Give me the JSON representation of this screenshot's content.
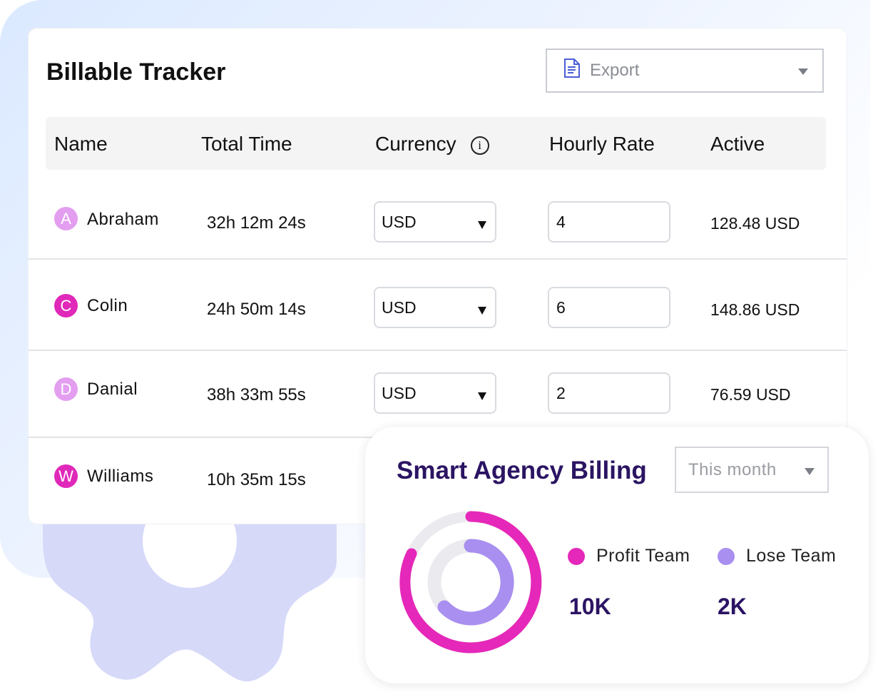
{
  "tracker": {
    "title": "Billable Tracker",
    "export_label": "Export",
    "columns": [
      "Name",
      "Total Time",
      "Currency",
      "Hourly Rate",
      "Active"
    ],
    "info_glyph": "i",
    "rows": [
      {
        "initial": "A",
        "name": "Abraham",
        "total_time": "32h 12m 24s",
        "currency": "USD",
        "hourly_rate": "4",
        "active": "128.48 USD",
        "avatar_color": "#e39ef0"
      },
      {
        "initial": "C",
        "name": "Colin",
        "total_time": "24h 50m 14s",
        "currency": "USD",
        "hourly_rate": "6",
        "active": "148.86 USD",
        "avatar_color": "#e028b9"
      },
      {
        "initial": "D",
        "name": "Danial",
        "total_time": "38h 33m 55s",
        "currency": "USD",
        "hourly_rate": "2",
        "active": "76.59 USD",
        "avatar_color": "#e39ef0"
      },
      {
        "initial": "W",
        "name": "Williams",
        "total_time": "10h 35m 15s",
        "avatar_color": "#e028b9"
      }
    ]
  },
  "billing": {
    "title": "Smart Agency Billing",
    "period": "This month",
    "legend": [
      {
        "label": "Profit Team",
        "value": "10K",
        "color": "#e528b9"
      },
      {
        "label": "Lose Team",
        "value": "2K",
        "color": "#a98ff0"
      }
    ]
  },
  "colors": {
    "accent_pink": "#e528b9",
    "accent_purple": "#a98ff0",
    "title_navy": "#2b1463",
    "gear": "#d6d9f8"
  }
}
